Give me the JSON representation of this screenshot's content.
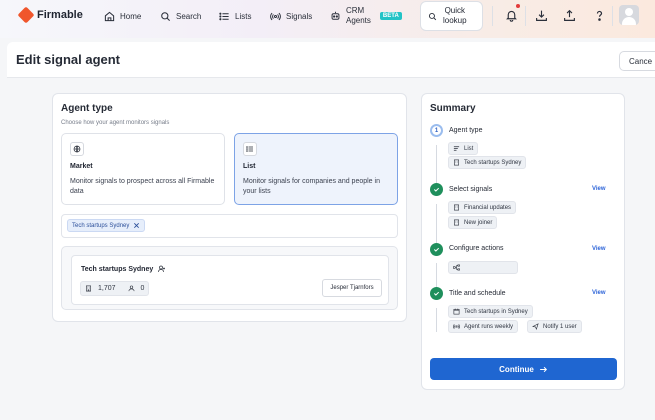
{
  "app": {
    "name": "Firmable",
    "brand_color": "#f0562c",
    "accent_color": "#1f66d1"
  },
  "nav": {
    "home": "Home",
    "search": "Search",
    "lists": "Lists",
    "signals": "Signals",
    "crm_line1": "CRM",
    "crm_line2": "Agents",
    "beta": "BETA",
    "quick_line1": "Quick",
    "quick_line2": "lookup"
  },
  "page": {
    "title": "Edit signal agent",
    "cancel": "Cance"
  },
  "agent_type": {
    "title": "Agent type",
    "subtitle": "Choose how your agent monitors signals",
    "options": [
      {
        "title": "Market",
        "desc": "Monitor signals to prospect across all Firmable data",
        "icon": "globe-icon",
        "selected": false
      },
      {
        "title": "List",
        "desc": "Monitor signals for companies and people in your lists",
        "icon": "list-icon",
        "selected": true
      }
    ],
    "selected_tag": "Tech startups Sydney",
    "list_card": {
      "name": "Tech startups Sydney",
      "companies": "1,707",
      "people": "0",
      "owner": "Jesper Tjarnfors"
    }
  },
  "summary": {
    "title": "Summary",
    "steps": [
      {
        "num": "1",
        "title": "Agent type",
        "status": "active",
        "chips": [
          "List",
          "Tech startups Sydney"
        ]
      },
      {
        "title": "Select signals",
        "status": "done",
        "view": "View",
        "chips": [
          "Financial updates",
          "New joiner"
        ]
      },
      {
        "title": "Configure actions",
        "status": "done",
        "view": "View",
        "chips": []
      },
      {
        "title": "Title and schedule",
        "status": "done",
        "view": "View",
        "chips": [
          "Tech startups in Sydney",
          "Agent runs weekly",
          "Notify 1 user"
        ]
      }
    ],
    "continue": "Continue"
  }
}
